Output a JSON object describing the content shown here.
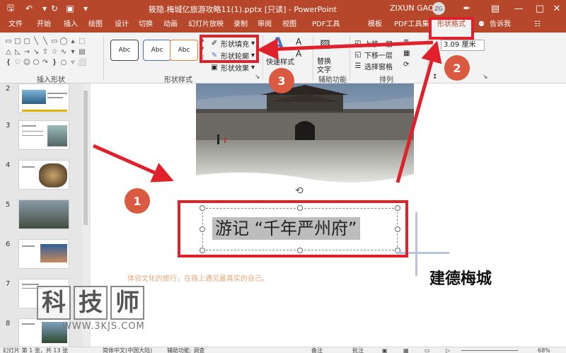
{
  "titlebar": {
    "title": "筱隐.梅城亿旅游攻略11(1).pptx [只读] - PowerPoint",
    "user": "ZIXUN GAO",
    "avatar_initials": "ZG",
    "icons": [
      "save-icon",
      "undo-icon",
      "redo-icon",
      "present-icon",
      "customize-icon"
    ],
    "window": [
      "ribbon-display-icon",
      "minimize-icon",
      "maximize-icon",
      "close-icon"
    ]
  },
  "tabs": [
    "文件",
    "开始",
    "插入",
    "绘图",
    "设计",
    "切换",
    "动画",
    "幻灯片放映",
    "录制",
    "审阅",
    "视图",
    "PDF工具",
    "模板",
    "PDF工具集",
    "形状格式",
    "告诉我"
  ],
  "active_tab": "形状格式",
  "ribbon": {
    "insert_shapes_label": "插入形状",
    "shape_styles_label": "形状样式",
    "style_boxes": [
      "Abc",
      "Abc",
      "Abc"
    ],
    "shape_fill": "形状填充",
    "shape_outline": "形状轮廓",
    "shape_effects": "形状效果",
    "wordart_letter": "A",
    "quick_styles": "快速样式",
    "alt_text": [
      "替换",
      "文字"
    ],
    "assist_label": "辅助功能",
    "bring_forward": "上移一层",
    "send_backward": "下移一层",
    "selection_pane": "选择窗格",
    "arrange_label": "排列",
    "size_value": "3.09 厘米"
  },
  "thumbnails": [
    "2",
    "3",
    "4",
    "5",
    "6",
    "7",
    "8"
  ],
  "slide": {
    "textbox_text": "游记 “千年严州府”",
    "subtitle": "体验文化的旅行，在路上遇见最真实的自己。",
    "right_title": "建德梅城"
  },
  "callouts": [
    "1",
    "2",
    "3"
  ],
  "watermark": {
    "chars": [
      "科",
      "技",
      "师"
    ],
    "url": "WWW.3KJS.COM"
  },
  "statusbar": {
    "slide_info": "幻灯片 第 1 张，共 13 张",
    "language": "简体中文(中国大陆)",
    "accessibility": "辅助功能: 调查",
    "notes": "备注",
    "comments": "批注",
    "zoom": "68%"
  },
  "colors": {
    "titlebar": "#b7472a",
    "highlight_red": "#e0202a",
    "callout": "#d95a40",
    "subtitle": "#e3a878"
  }
}
